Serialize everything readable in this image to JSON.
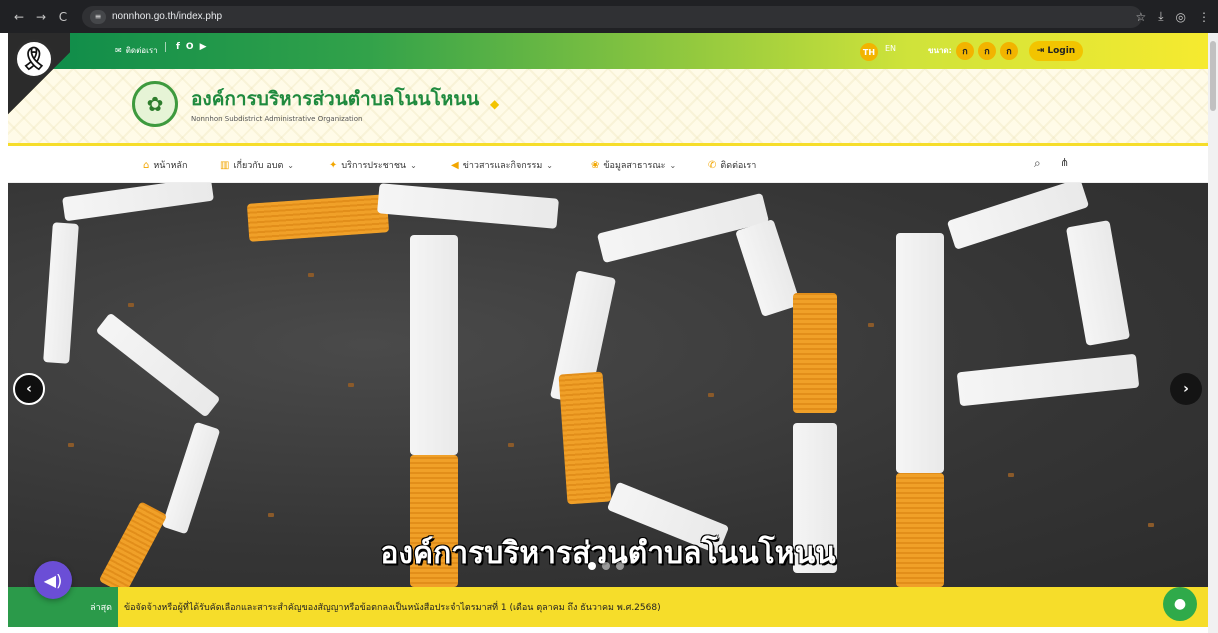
{
  "browser": {
    "url": "nonnhon.go.th/index.php",
    "back_icon": "←",
    "forward_icon": "→",
    "reload_icon": "C",
    "site_info_icon": "≡",
    "star_icon": "☆",
    "download_icon": "⤓",
    "profile_icon": "◎",
    "menu_icon": "⋮"
  },
  "topbar": {
    "contact_label": "ติดต่อเรา",
    "social": [
      "f",
      "O",
      "▶"
    ],
    "lang_th": "TH",
    "lang_en": "EN",
    "font_size_label": "ขนาด:",
    "font_sizes": [
      "ก",
      "ก",
      "ก"
    ],
    "login_label": "Login",
    "colors": {
      "green": "#0b8a4a",
      "yellow": "#f6ea2f",
      "accent": "#f2c400"
    }
  },
  "header": {
    "org_name_th": "องค์การบริหารส่วนตำบลโนนโหนน",
    "org_name_en": "Nonnhon Subdistrict Administrative Organization"
  },
  "menu": {
    "items": [
      {
        "label": "หน้าหลัก",
        "icon": "⌂",
        "has_dropdown": false
      },
      {
        "label": "เกี่ยวกับ อบต",
        "icon": "▥",
        "has_dropdown": true
      },
      {
        "label": "บริการประชาชน",
        "icon": "✦",
        "has_dropdown": true
      },
      {
        "label": "ข่าวสารและกิจกรรม",
        "icon": "◀",
        "has_dropdown": true
      },
      {
        "label": "ข้อมูลสาธารณะ",
        "icon": "❀",
        "has_dropdown": true
      },
      {
        "label": "ติดต่อเรา",
        "icon": "✆",
        "has_dropdown": false
      }
    ],
    "search_icon": "⌕",
    "sitemap_icon": "⋔"
  },
  "hero": {
    "caption": "องค์การบริหารส่วนตำบลโนนโหนน",
    "prev_icon": "‹",
    "next_icon": "›",
    "slide_count": 3,
    "active_slide": 1
  },
  "ticker": {
    "label": "ล่าสุด",
    "text": "ข้อจัดจ้างหรือผู้ที่ได้รับคัดเลือกและสาระสำคัญของสัญญาหรือข้อตกลงเป็นหนังสือประจำไตรมาสที่ 1 (เดือน ตุลาคม ถึง ธันวาคม พ.ศ.2568)"
  },
  "floating": {
    "voice_icon": "◀)",
    "chat_icon": "●"
  }
}
